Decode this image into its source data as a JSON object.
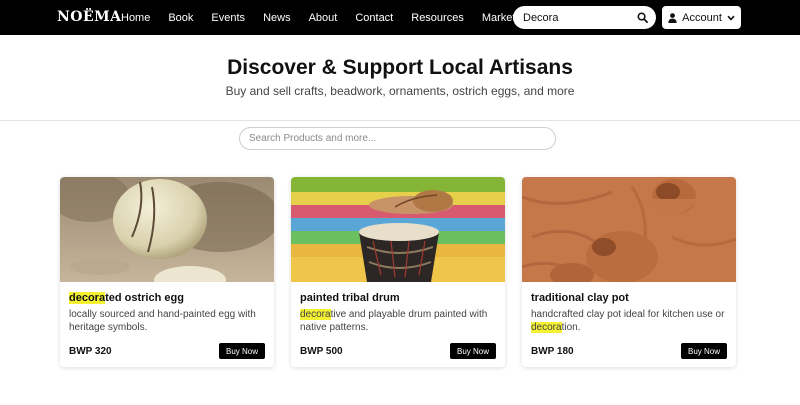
{
  "brand": {
    "logo_text": "NOËMA"
  },
  "nav": {
    "links": [
      "Home",
      "Book",
      "Events",
      "News",
      "About",
      "Contact",
      "Resources",
      "Marketplace"
    ]
  },
  "top_search": {
    "value": "Decora",
    "icon": "search-icon"
  },
  "account": {
    "label": "Account",
    "icon": "user-icon"
  },
  "hero": {
    "title": "Discover & Support Local Artisans",
    "subtitle": "Buy and sell crafts, beadwork, ornaments, ostrich eggs, and more"
  },
  "main_search": {
    "placeholder": "Search Products and more..."
  },
  "highlight_color": "#f4f133",
  "products": [
    {
      "title_hl": "decora",
      "title_rest": "ted ostrich egg",
      "desc_before": "locally sourced and hand-painted egg with heritage symbols.",
      "desc_hl": "",
      "desc_after": "",
      "price": "BWP 320",
      "button": "Buy Now"
    },
    {
      "title_hl": "",
      "title_rest": "painted tribal drum",
      "desc_before": "",
      "desc_hl": "decora",
      "desc_after": "tive and playable drum painted with native patterns.",
      "price": "BWP 500",
      "button": "Buy Now"
    },
    {
      "title_hl": "",
      "title_rest": "traditional clay pot",
      "desc_before": "handcrafted clay pot ideal for kitchen use or ",
      "desc_hl": "decora",
      "desc_after": "tion.",
      "price": "BWP 180",
      "button": "Buy Now"
    }
  ]
}
